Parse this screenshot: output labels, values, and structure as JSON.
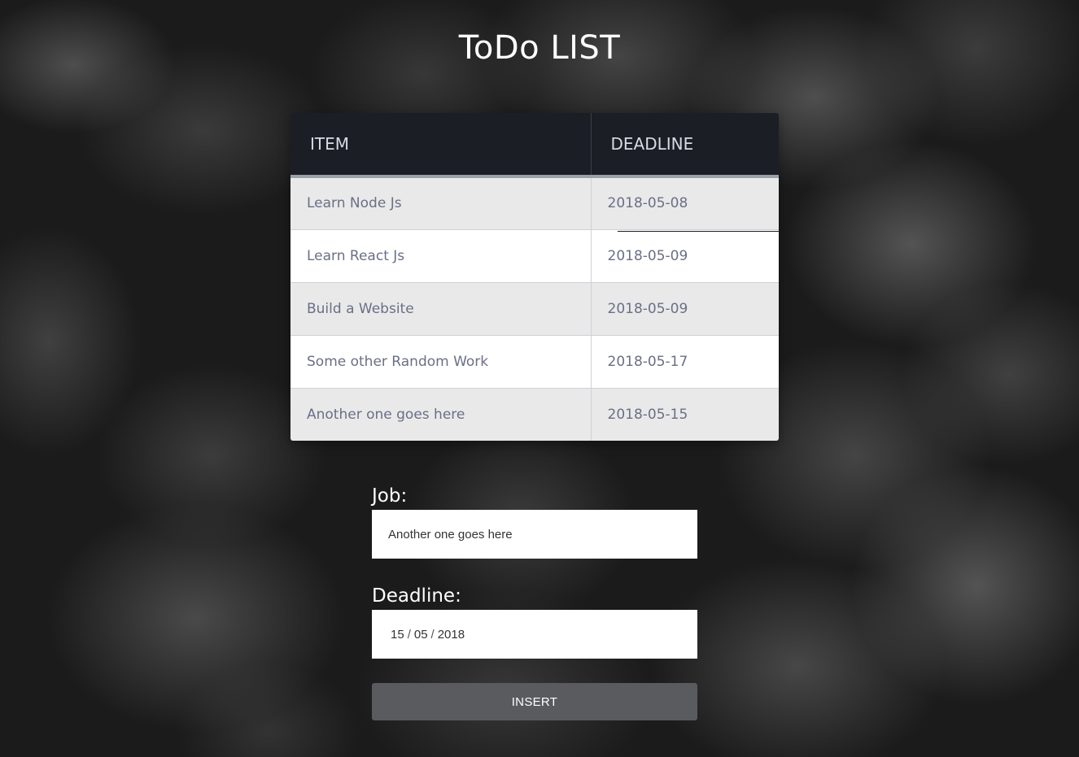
{
  "page": {
    "title": "ToDo LIST"
  },
  "table": {
    "headers": {
      "item": "ITEM",
      "deadline": "DEADLINE"
    },
    "rows": [
      {
        "item": "Learn Node Js",
        "deadline": "2018-05-08"
      },
      {
        "item": "Learn React Js",
        "deadline": "2018-05-09"
      },
      {
        "item": "Build a Website",
        "deadline": "2018-05-09"
      },
      {
        "item": "Some other Random Work",
        "deadline": "2018-05-17"
      },
      {
        "item": "Another one goes here",
        "deadline": "2018-05-15"
      }
    ]
  },
  "form": {
    "job_label": "Job:",
    "job_value": "Another one goes here",
    "deadline_label": "Deadline:",
    "deadline_day": "15",
    "deadline_month": "05",
    "deadline_year": "2018",
    "date_separator": "/",
    "insert_label": "INSERT"
  },
  "colors": {
    "header_bg": "#1b1e25",
    "row_alt_bg": "#e9e9ea",
    "cell_text": "#6b6f85",
    "button_bg": "#5a5b5f"
  }
}
